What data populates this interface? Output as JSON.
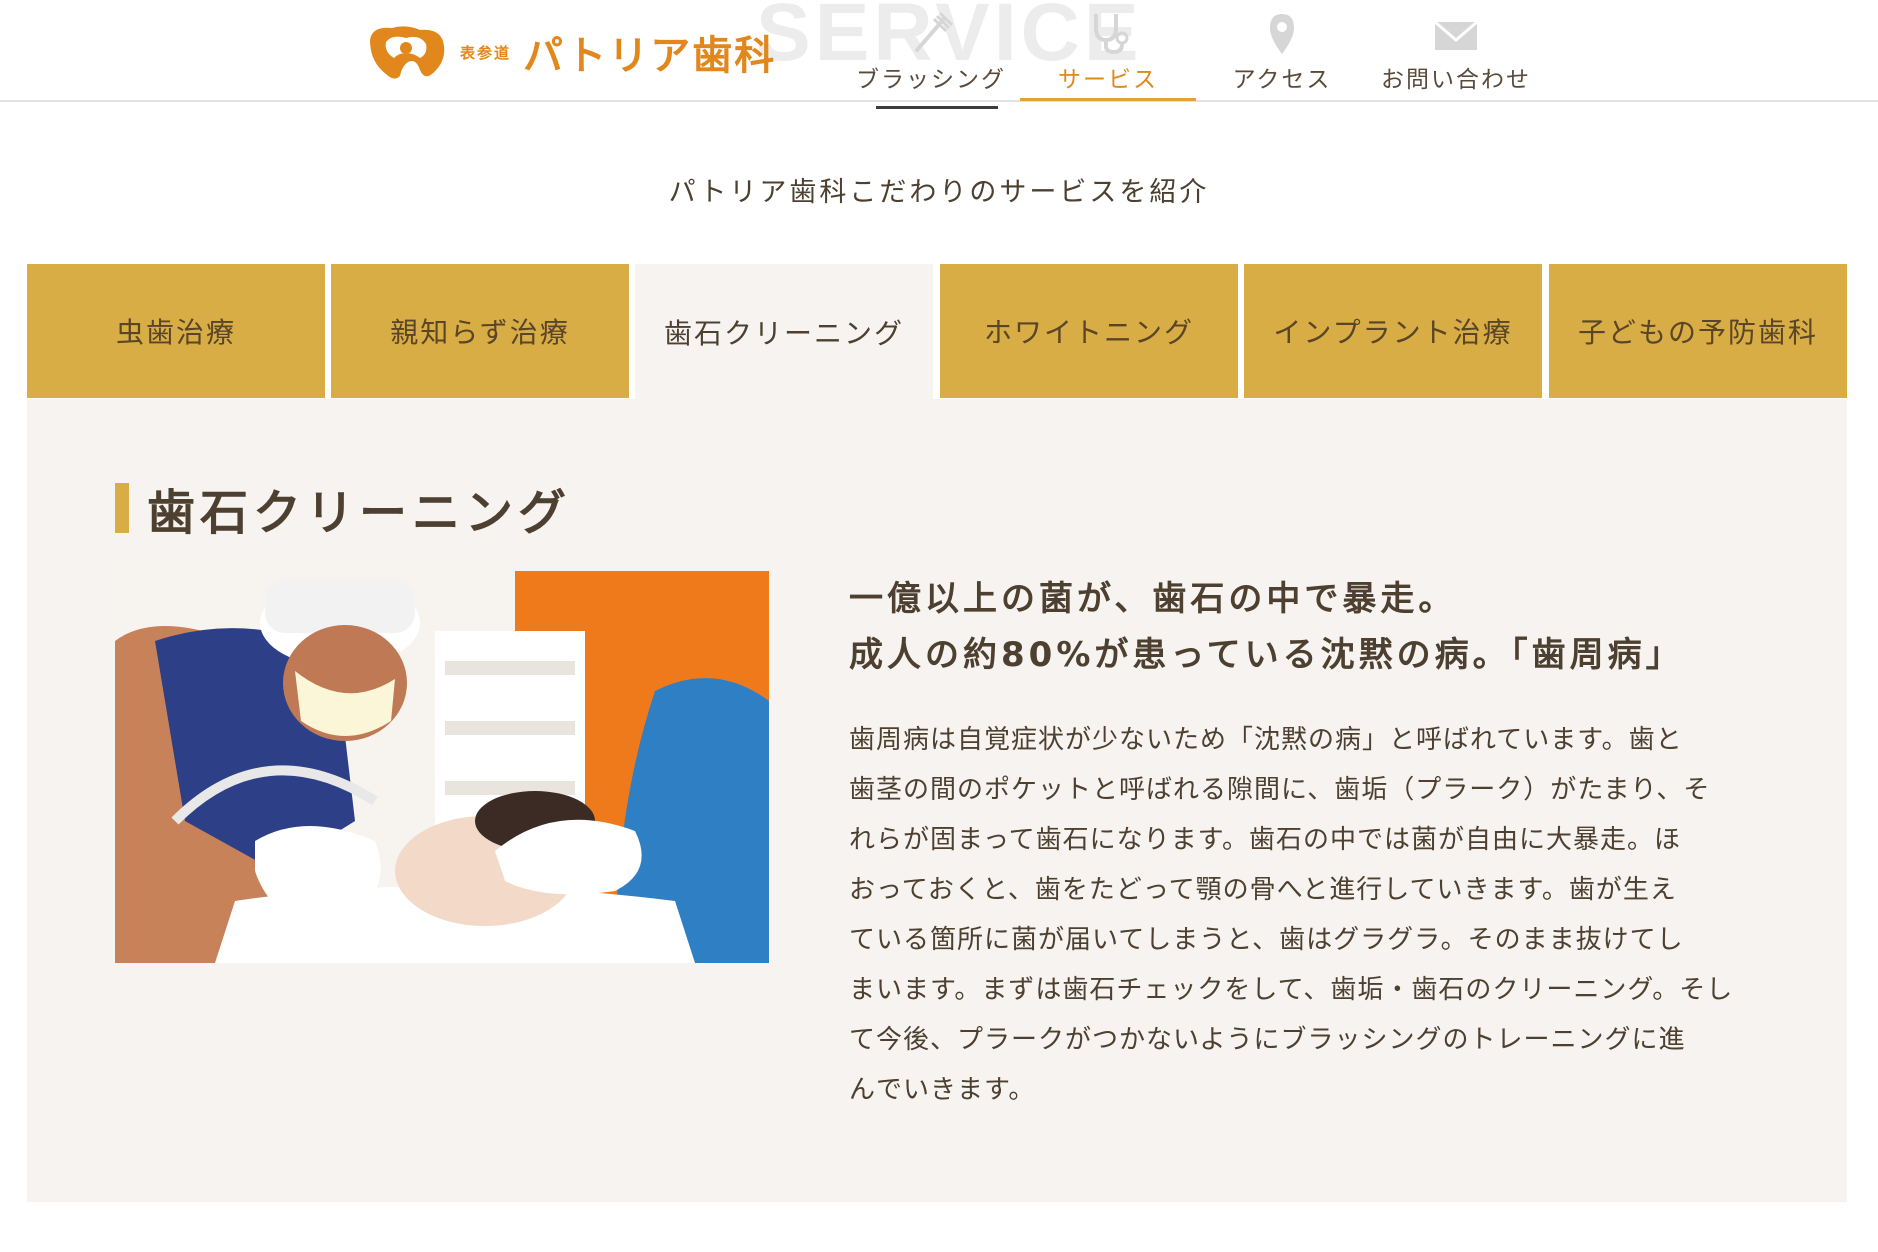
{
  "header": {
    "logo": {
      "area": "表参道",
      "name": "パトリア歯科"
    },
    "watermark": "SERVICE",
    "nav": [
      {
        "label": "ブラッシング",
        "icon": "toothbrush-icon",
        "active": false
      },
      {
        "label": "サービス",
        "icon": "stethoscope-icon",
        "active": true
      },
      {
        "label": "アクセス",
        "icon": "map-pin-icon",
        "active": false
      },
      {
        "label": "お問い合わせ",
        "icon": "mail-icon",
        "active": false
      }
    ]
  },
  "subtitle": "パトリア歯科こだわりのサービスを紹介",
  "tabs": [
    {
      "label": "虫歯治療",
      "active": false
    },
    {
      "label": "親知らず治療",
      "active": false
    },
    {
      "label": "歯石クリーニング",
      "active": true
    },
    {
      "label": "ホワイトニング",
      "active": false
    },
    {
      "label": "インプラント治療",
      "active": false
    },
    {
      "label": "子どもの予防歯科",
      "active": false
    }
  ],
  "section": {
    "title": "歯石クリーニング",
    "headline_line1": "一億以上の菌が、歯石の中で暴走。",
    "headline_line2": "成人の約80%が患っている沈黙の病。「歯周病」",
    "body": [
      "歯周病は自覚症状が少ないため「沈黙の病」と呼ばれています。歯と",
      "歯茎の間のポケットと呼ばれる隙間に、歯垢（プラーク）がたまり、そ",
      "れらが固まって歯石になります。歯石の中では菌が自由に大暴走。ほ",
      "おっておくと、歯をたどって顎の骨へと進行していきます。歯が生え",
      "ている箇所に菌が届いてしまうと、歯はグラグラ。そのまま抜けてし",
      "まいます。まずは歯石チェックをして、歯垢・歯石のクリーニング。そし",
      "て今後、プラークがつかないようにブラッシングのトレーニングに進",
      "んでいきます。"
    ]
  },
  "colors": {
    "brand_orange": "#e2871b",
    "tab_gold": "#d8ad45",
    "panel_bg": "#f6f3f0",
    "text_brown": "#4d4030"
  }
}
